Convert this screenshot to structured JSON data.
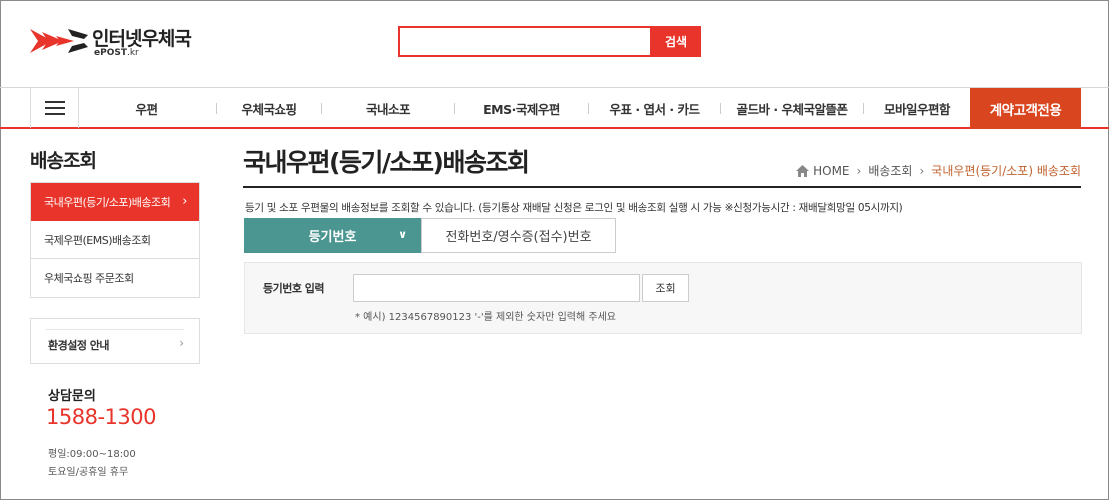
{
  "header": {
    "logo_text": "인터넷우체국",
    "logo_sub_bold": "ePOST",
    "logo_sub_domain": ".kr",
    "search_placeholder": "",
    "search_button": "검색"
  },
  "gnb": {
    "items": [
      "우편",
      "우체국쇼핑",
      "국내소포",
      "EMS·국제우편",
      "우표 · 엽서 · 카드",
      "골드바 · 우체국알뜰폰",
      "모바일우편함"
    ],
    "special": "계약고객전용"
  },
  "sidebar": {
    "title": "배송조회",
    "items": [
      {
        "label": "국내우편(등기/소포)배송조회",
        "active": true
      },
      {
        "label": "국제우편(EMS)배송조회",
        "active": false
      },
      {
        "label": "우체국쇼핑 주문조회",
        "active": false
      }
    ],
    "env_label": "환경설정 안내",
    "contact": {
      "title": "상담문의",
      "phone": "1588-1300",
      "hours_weekday": "평일:09:00~18:00",
      "hours_weekend": "토요일/공휴일 휴무"
    }
  },
  "main": {
    "title": "국내우편(등기/소포)배송조회",
    "breadcrumb": [
      "HOME",
      "배송조회",
      "국내우편(등기/소포) 배송조회"
    ],
    "description": "등기 및 소포 우편물의 배송정보를 조회할 수 있습니다. (등기통상 재배달 신청은 로그인 및 배송조회 실행 시 가능 ※신청가능시간 : 재배달희망일 05시까지)",
    "tabs": [
      "등기번호",
      "전화번호/영수증(접수)번호"
    ],
    "form": {
      "label": "등기번호 입력",
      "input_value": "",
      "button": "조회",
      "help": "* 예시) 1234567890123 '-'를 제외한 숫자만 입력해 주세요"
    }
  },
  "colors": {
    "accent": "#e8342a",
    "special": "#d9451f",
    "tab_active": "#4c9692",
    "breadcrumb_current": "#c0622e"
  },
  "icons": [
    "epost-logo-icon",
    "menu-icon",
    "home-icon",
    "chevron-right-icon",
    "chevron-down-icon"
  ]
}
